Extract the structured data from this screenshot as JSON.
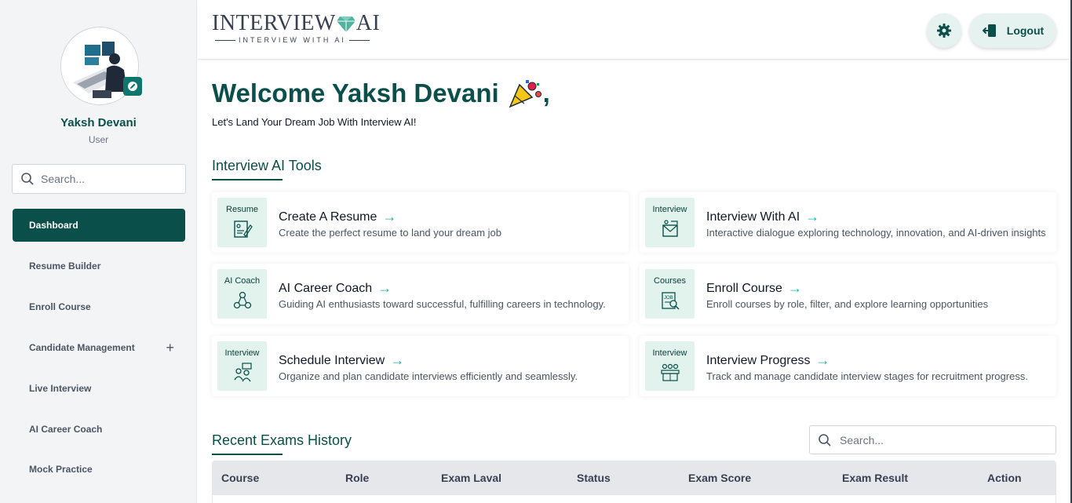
{
  "sidebar": {
    "user_name": "Yaksh Devani",
    "user_role": "User",
    "search_placeholder": "Search...",
    "items": [
      {
        "label": "Dashboard",
        "active": true
      },
      {
        "label": "Resume Builder"
      },
      {
        "label": "Enroll Course"
      },
      {
        "label": "Candidate Management",
        "expandable": true
      },
      {
        "label": "Live Interview"
      },
      {
        "label": "AI Career Coach"
      },
      {
        "label": "Mock Practice"
      }
    ]
  },
  "header": {
    "logo_main_left": "INTERVIEW",
    "logo_main_right": "AI",
    "logo_sub": "INTERVIEW WITH AI",
    "logout_label": "Logout"
  },
  "main": {
    "welcome_title": "Welcome Yaksh Devani",
    "welcome_suffix": ",",
    "welcome_subtitle": "Let's Land Your Dream Job With Interview AI!",
    "tools_title": "Interview AI Tools",
    "tools": [
      {
        "tag": "Resume",
        "title": "Create A Resume",
        "desc": "Create the perfect resume to land your dream job"
      },
      {
        "tag": "Interview",
        "title": "Interview With AI",
        "desc": "Interactive dialogue exploring technology, innovation, and AI-driven insights"
      },
      {
        "tag": "AI Coach",
        "title": "AI Career Coach",
        "desc": "Guiding AI enthusiasts toward successful, fulfilling careers in technology."
      },
      {
        "tag": "Courses",
        "title": "Enroll Course",
        "desc": "Enroll courses by role, filter, and explore learning opportunities"
      },
      {
        "tag": "Interview",
        "title": "Schedule Interview",
        "desc": "Organize and plan candidate interviews efficiently and seamlessly."
      },
      {
        "tag": "Interview",
        "title": "Interview Progress",
        "desc": "Track and manage candidate interview stages for recruitment progress."
      }
    ],
    "arrow": "→",
    "exams_title": "Recent Exams History",
    "exams_search_placeholder": "Search...",
    "table_headers": [
      "Course",
      "Role",
      "Exam Laval",
      "Status",
      "Exam Score",
      "Exam Result",
      "Action"
    ]
  },
  "colors": {
    "brand": "#0b4f4a",
    "accent": "#14b8a6",
    "card_icon_bg": "#e2f2ec",
    "sidebar_bg": "#f3f4f6"
  }
}
